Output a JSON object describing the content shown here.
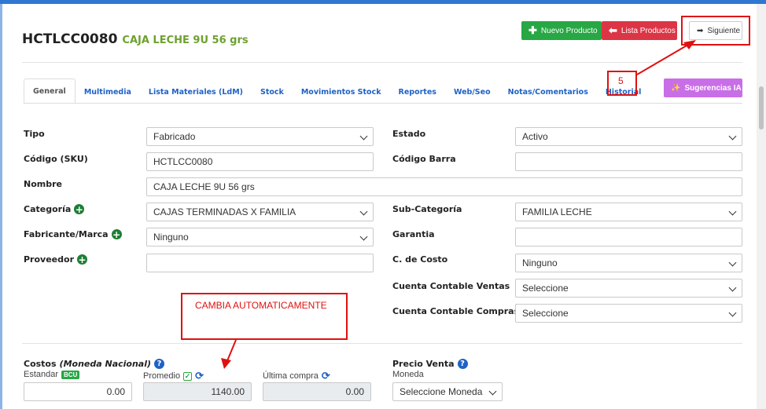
{
  "product": {
    "code": "HCTLCC0080",
    "name": "CAJA LECHE 9U 56 grs"
  },
  "actions": {
    "new_product": "Nuevo Producto",
    "product_list": "Lista Productos",
    "next": "Siguiente",
    "ai_suggestions": "Sugerencias IA"
  },
  "tabs": [
    {
      "label": "General",
      "active": true
    },
    {
      "label": "Multimedia"
    },
    {
      "label": "Lista Materiales (LdM)"
    },
    {
      "label": "Stock"
    },
    {
      "label": "Movimientos Stock"
    },
    {
      "label": "Reportes"
    },
    {
      "label": "Web/Seo"
    },
    {
      "label": "Notas/Comentarios"
    },
    {
      "label": "Historial"
    }
  ],
  "form": {
    "tipo": {
      "label": "Tipo",
      "value": "Fabricado"
    },
    "estado": {
      "label": "Estado",
      "value": "Activo"
    },
    "sku": {
      "label": "Código (SKU)",
      "value": "HCTLCC0080"
    },
    "barcode": {
      "label": "Código Barra",
      "value": ""
    },
    "nombre": {
      "label": "Nombre",
      "value": "CAJA LECHE 9U 56 grs"
    },
    "categoria": {
      "label": "Categoría",
      "value": "CAJAS TERMINADAS X FAMILIA"
    },
    "subcategoria": {
      "label": "Sub-Categoría",
      "value": "FAMILIA LECHE"
    },
    "fabricante": {
      "label": "Fabricante/Marca",
      "value": "Ninguno"
    },
    "garantia": {
      "label": "Garantia",
      "value": ""
    },
    "proveedor": {
      "label": "Proveedor",
      "value": ""
    },
    "centro_costo": {
      "label": "C. de Costo",
      "value": "Ninguno"
    },
    "cuenta_ventas": {
      "label": "Cuenta Contable Ventas",
      "value": "Seleccione"
    },
    "cuenta_compras": {
      "label": "Cuenta Contable Compras",
      "value": "Seleccione"
    }
  },
  "costos": {
    "title": "Costos",
    "subtitle": "(Moneda Nacional)",
    "standard_label": "Estandar",
    "standard_badge": "BCU",
    "standard_value": "0.00",
    "average_label": "Promedio",
    "average_value": "1140.00",
    "last_label": "Última compra",
    "last_value": "0.00"
  },
  "precio": {
    "title": "Precio Venta",
    "currency_label": "Moneda",
    "currency_value": "Seleccione Moneda"
  },
  "annotations": {
    "step": "5",
    "auto_note": "CAMBIA AUTOMATICAMENTE",
    "color": "#e01010"
  },
  "colors": {
    "accent": "#1f62c5",
    "success": "#28a745",
    "danger": "#dc3545",
    "ai": "#c86ee6",
    "subtitle": "#6da12e"
  }
}
